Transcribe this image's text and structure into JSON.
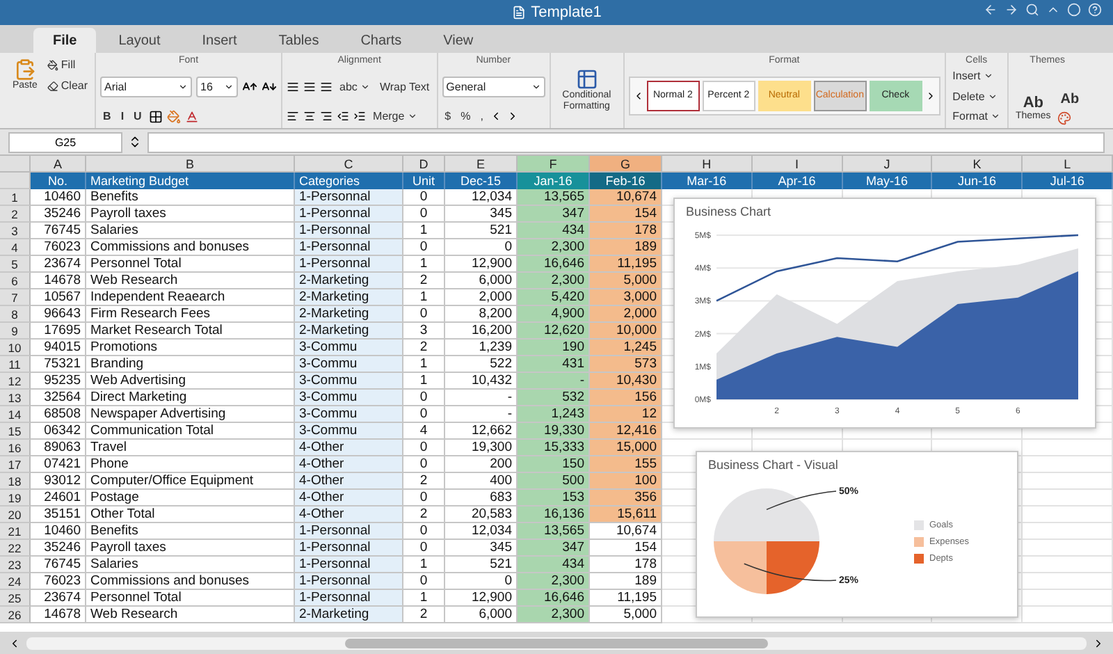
{
  "window": {
    "title": "Template1"
  },
  "ribbon_tabs": [
    {
      "label": "File",
      "selected": true
    },
    {
      "label": "Layout",
      "selected": false
    },
    {
      "label": "Insert",
      "selected": false
    },
    {
      "label": "Tables",
      "selected": false
    },
    {
      "label": "Charts",
      "selected": false
    },
    {
      "label": "View",
      "selected": false
    }
  ],
  "ribbon": {
    "paste": "Paste",
    "fill": "Fill",
    "clear": "Clear",
    "font_group": "Font",
    "font_name": "Arial",
    "font_size": "16",
    "text_styles": [
      "B",
      "I",
      "U"
    ],
    "alignment_group": "Alignment",
    "alignment_style": "abc",
    "wrap_text": "Wrap Text",
    "merge": "Merge",
    "number_group": "Number",
    "number_format": "General",
    "number_buttons": [
      "$",
      "%",
      ","
    ],
    "conditional_formatting": "Conditional Formatting",
    "format_group": "Format",
    "cell_styles": [
      {
        "label": "Normal 2",
        "kind": "normal"
      },
      {
        "label": "Percent 2",
        "kind": "percent"
      },
      {
        "label": "Neutral",
        "kind": "neutral"
      },
      {
        "label": "Calculation",
        "kind": "calculation"
      },
      {
        "label": "Check",
        "kind": "check"
      }
    ],
    "cells_group": "Cells",
    "cell_actions": [
      "Insert",
      "Delete",
      "Format"
    ],
    "themes_group": "Themes",
    "themes": "Themes",
    "theme_samples": [
      "Ab",
      "Ab"
    ]
  },
  "name_box": "G25",
  "columns": [
    {
      "letter": "A",
      "heading": "No.",
      "kind": "plain"
    },
    {
      "letter": "B",
      "heading": "Marketing Budget",
      "kind": "plain"
    },
    {
      "letter": "C",
      "heading": "Categories",
      "kind": "plain"
    },
    {
      "letter": "D",
      "heading": "Unit",
      "kind": "plain"
    },
    {
      "letter": "E",
      "heading": "Dec-15",
      "kind": "plain"
    },
    {
      "letter": "F",
      "heading": "Jan-16",
      "kind": "green"
    },
    {
      "letter": "G",
      "heading": "Feb-16",
      "kind": "orange"
    },
    {
      "letter": "H",
      "heading": "Mar-16",
      "kind": "plain"
    },
    {
      "letter": "I",
      "heading": "Apr-16",
      "kind": "plain"
    },
    {
      "letter": "J",
      "heading": "May-16",
      "kind": "plain"
    },
    {
      "letter": "K",
      "heading": "Jun-16",
      "kind": "plain"
    },
    {
      "letter": "L",
      "heading": "Jul-16",
      "kind": "plain"
    }
  ],
  "rows": [
    {
      "number": "1",
      "no": "10460",
      "item": "Benefits",
      "category": "1-Personnal",
      "unit": "0",
      "dec": "12,034",
      "jan": "13,565",
      "feb": "10,674",
      "feb_highlight": true
    },
    {
      "number": "2",
      "no": "35246",
      "item": "Payroll taxes",
      "category": "1-Personnal",
      "unit": "0",
      "dec": "345",
      "jan": "347",
      "feb": "154",
      "feb_highlight": true
    },
    {
      "number": "3",
      "no": "76745",
      "item": "Salaries",
      "category": "1-Personnal",
      "unit": "1",
      "dec": "521",
      "jan": "434",
      "feb": "178",
      "feb_highlight": true
    },
    {
      "number": "4",
      "no": "76023",
      "item": "Commissions and bonuses",
      "category": "1-Personnal",
      "unit": "0",
      "dec": "0",
      "jan": "2,300",
      "feb": "189",
      "feb_highlight": true
    },
    {
      "number": "5",
      "no": "23674",
      "item": "Personnel Total",
      "category": "1-Personnal",
      "unit": "1",
      "dec": "12,900",
      "jan": "16,646",
      "feb": "11,195",
      "feb_highlight": true
    },
    {
      "number": "6",
      "no": "14678",
      "item": "Web Research",
      "category": "2-Marketing",
      "unit": "2",
      "dec": "6,000",
      "jan": "2,300",
      "feb": "5,000",
      "feb_highlight": true
    },
    {
      "number": "7",
      "no": "10567",
      "item": "Independent Reaearch",
      "category": "2-Marketing",
      "unit": "1",
      "dec": "2,000",
      "jan": "5,420",
      "feb": "3,000",
      "feb_highlight": true
    },
    {
      "number": "8",
      "no": "96643",
      "item": "Firm Research Fees",
      "category": "2-Marketing",
      "unit": "0",
      "dec": "8,200",
      "jan": "4,900",
      "feb": "2,000",
      "feb_highlight": true
    },
    {
      "number": "9",
      "no": "17695",
      "item": "Market Research Total",
      "category": "2-Marketing",
      "unit": "3",
      "dec": "16,200",
      "jan": "12,620",
      "feb": "10,000",
      "feb_highlight": true
    },
    {
      "number": "10",
      "no": "94015",
      "item": "Promotions",
      "category": "3-Commu",
      "unit": "2",
      "dec": "1,239",
      "jan": "190",
      "feb": "1,245",
      "feb_highlight": true
    },
    {
      "number": "11",
      "no": "75321",
      "item": "Branding",
      "category": "3-Commu",
      "unit": "1",
      "dec": "522",
      "jan": "431",
      "feb": "573",
      "feb_highlight": true
    },
    {
      "number": "12",
      "no": "95235",
      "item": "Web Advertising",
      "category": "3-Commu",
      "unit": "1",
      "dec": "10,432",
      "jan": "-",
      "feb": "10,430",
      "feb_highlight": true
    },
    {
      "number": "13",
      "no": "32564",
      "item": "Direct Marketing",
      "category": "3-Commu",
      "unit": "0",
      "dec": "-",
      "jan": "532",
      "feb": "156",
      "feb_highlight": true
    },
    {
      "number": "14",
      "no": "68508",
      "item": "Newspaper Advertising",
      "category": "3-Commu",
      "unit": "0",
      "dec": "-",
      "jan": "1,243",
      "feb": "12",
      "feb_highlight": true
    },
    {
      "number": "15",
      "no": "06342",
      "item": "Communication Total",
      "category": "3-Commu",
      "unit": "4",
      "dec": "12,662",
      "jan": "19,330",
      "feb": "12,416",
      "feb_highlight": true
    },
    {
      "number": "16",
      "no": "89063",
      "item": "Travel",
      "category": "4-Other",
      "unit": "0",
      "dec": "19,300",
      "jan": "15,333",
      "feb": "15,000",
      "feb_highlight": true
    },
    {
      "number": "17",
      "no": "07421",
      "item": "Phone",
      "category": "4-Other",
      "unit": "0",
      "dec": "200",
      "jan": "150",
      "feb": "155",
      "feb_highlight": true
    },
    {
      "number": "18",
      "no": "93012",
      "item": "Computer/Office Equipment",
      "category": "4-Other",
      "unit": "2",
      "dec": "400",
      "jan": "500",
      "feb": "100",
      "feb_highlight": true
    },
    {
      "number": "19",
      "no": "24601",
      "item": "Postage",
      "category": "4-Other",
      "unit": "0",
      "dec": "683",
      "jan": "153",
      "feb": "356",
      "feb_highlight": true
    },
    {
      "number": "20",
      "no": "35151",
      "item": "Other Total",
      "category": "4-Other",
      "unit": "2",
      "dec": "20,583",
      "jan": "16,136",
      "feb": "15,611",
      "feb_highlight": true
    },
    {
      "number": "21",
      "no": "10460",
      "item": "Benefits",
      "category": "1-Personnal",
      "unit": "0",
      "dec": "12,034",
      "jan": "13,565",
      "feb": "10,674",
      "feb_highlight": false
    },
    {
      "number": "22",
      "no": "35246",
      "item": "Payroll taxes",
      "category": "1-Personnal",
      "unit": "0",
      "dec": "345",
      "jan": "347",
      "feb": "154",
      "feb_highlight": false
    },
    {
      "number": "23",
      "no": "76745",
      "item": "Salaries",
      "category": "1-Personnal",
      "unit": "1",
      "dec": "521",
      "jan": "434",
      "feb": "178",
      "feb_highlight": false
    },
    {
      "number": "24",
      "no": "76023",
      "item": "Commissions and bonuses",
      "category": "1-Personnal",
      "unit": "0",
      "dec": "0",
      "jan": "2,300",
      "feb": "189",
      "feb_highlight": false
    },
    {
      "number": "25",
      "no": "23674",
      "item": "Personnel Total",
      "category": "1-Personnal",
      "unit": "1",
      "dec": "12,900",
      "jan": "16,646",
      "feb": "11,195",
      "feb_highlight": false
    },
    {
      "number": "26",
      "no": "14678",
      "item": "Web Research",
      "category": "2-Marketing",
      "unit": "2",
      "dec": "6,000",
      "jan": "2,300",
      "feb": "5,000",
      "feb_highlight": false
    }
  ],
  "charts": [
    {
      "title": "Business Chart",
      "chart_data": {
        "type": "area",
        "x": [
          1,
          2,
          3,
          4,
          5,
          6,
          7
        ],
        "xlim": [
          1,
          7
        ],
        "xticks": [
          2,
          3,
          4,
          5,
          6
        ],
        "ylim": [
          0,
          5
        ],
        "grid": true,
        "yticks": [
          {
            "value": 0,
            "label": "0M$"
          },
          {
            "value": 1,
            "label": "1M$"
          },
          {
            "value": 2,
            "label": "2M$"
          },
          {
            "value": 3,
            "label": "3M$"
          },
          {
            "value": 4,
            "label": "4M$"
          },
          {
            "value": 5,
            "label": "5M$"
          }
        ],
        "stacked": false,
        "series": [
          {
            "type": "area",
            "color": "#dedfe2",
            "values": [
              1.4,
              3.2,
              2.3,
              3.6,
              3.9,
              4.1,
              4.6
            ]
          },
          {
            "type": "area",
            "color": "#3a62a8",
            "values": [
              0.6,
              1.4,
              1.9,
              1.6,
              2.9,
              3.1,
              3.9
            ]
          },
          {
            "type": "line",
            "color": "#2f5597",
            "values": [
              3.0,
              3.9,
              4.3,
              4.2,
              4.8,
              4.9,
              5.0
            ]
          }
        ]
      }
    },
    {
      "title": "Business Chart - Visual",
      "legend": [
        {
          "color": "#e4e4e6"
        },
        {
          "color": "#f6bf9c"
        },
        {
          "color": "#e5632b"
        }
      ],
      "chart_data": {
        "type": "pie",
        "categories": [
          "Goals",
          "Expenses",
          "Depts"
        ],
        "values": [
          50,
          25,
          25
        ],
        "annotations": [
          {
            "text": "50%"
          },
          {
            "text": "25%"
          }
        ]
      }
    }
  ]
}
